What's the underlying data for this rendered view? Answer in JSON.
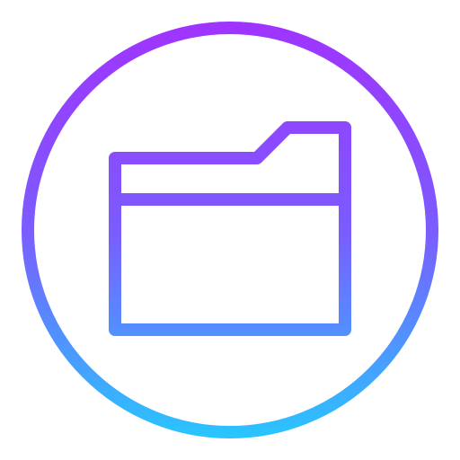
{
  "icon": {
    "name": "folder-icon",
    "gradient": {
      "top_color": "#a033ff",
      "mid_color": "#7b5cff",
      "bottom_color": "#29c5ff"
    },
    "background_color": "#ffffff"
  }
}
